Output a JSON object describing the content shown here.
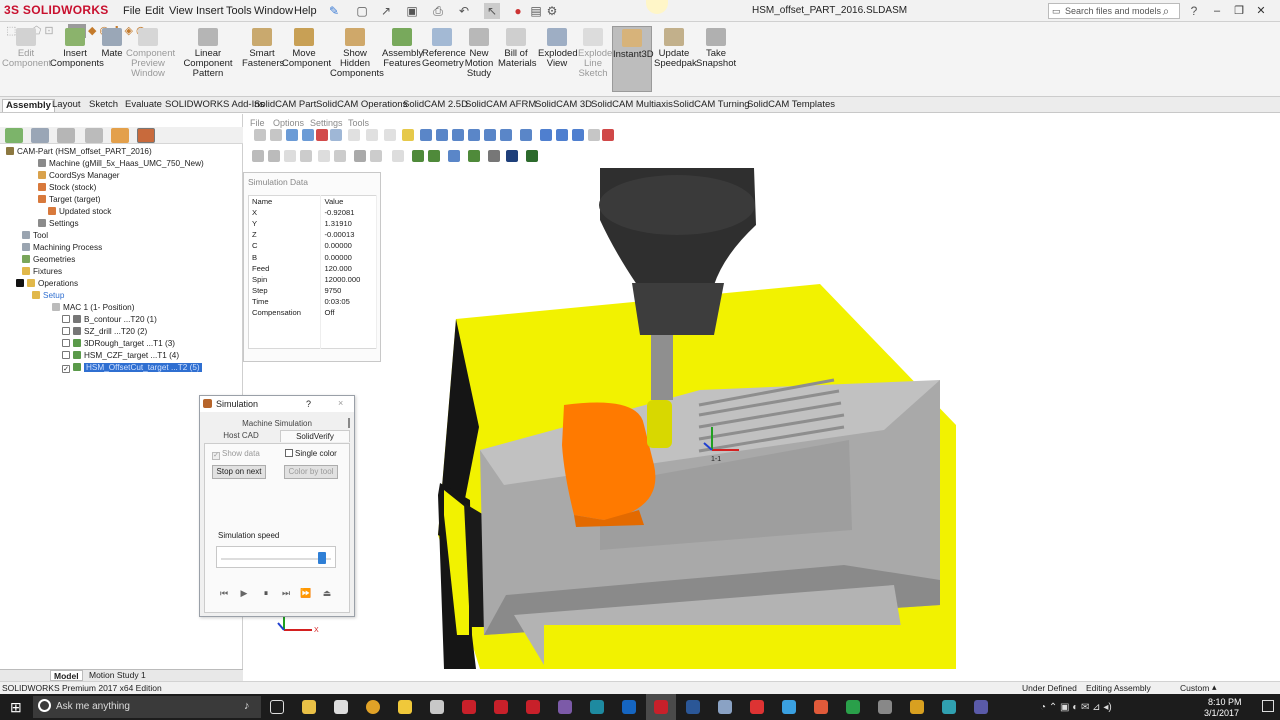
{
  "app": {
    "logo_prefix": "3S",
    "logo": "SOLIDWORKS",
    "document_title": "HSM_offset_PART_2016.SLDASM"
  },
  "menu": [
    "File",
    "Edit",
    "View",
    "Insert",
    "Tools",
    "Window",
    "Help"
  ],
  "search": {
    "placeholder": "Search files and models"
  },
  "toolbar_buttons": [
    {
      "label": "Edit Component",
      "enabled": false
    },
    {
      "label": "Insert Components",
      "enabled": true
    },
    {
      "label": "Mate",
      "enabled": true
    },
    {
      "label": "Component Preview Window",
      "enabled": false
    },
    {
      "label": "Linear Component Pattern",
      "enabled": true
    },
    {
      "label": "Smart Fasteners",
      "enabled": true
    },
    {
      "label": "Move Component",
      "enabled": true
    },
    {
      "label": "Show Hidden Components",
      "enabled": true
    },
    {
      "label": "Assembly Features",
      "enabled": true
    },
    {
      "label": "Reference Geometry",
      "enabled": true
    },
    {
      "label": "New Motion Study",
      "enabled": true
    },
    {
      "label": "Bill of Materials",
      "enabled": true
    },
    {
      "label": "Exploded View",
      "enabled": true
    },
    {
      "label": "Explode Line Sketch",
      "enabled": false
    },
    {
      "label": "Instant3D",
      "enabled": true,
      "active": true
    },
    {
      "label": "Update Speedpak",
      "enabled": true
    },
    {
      "label": "Take Snapshot",
      "enabled": true
    }
  ],
  "tabs": [
    "Assembly",
    "Layout",
    "Sketch",
    "Evaluate",
    "SOLIDWORKS Add-Ins",
    "SolidCAM Part",
    "SolidCAM Operations",
    "SolidCAM 2.5D",
    "SolidCAM AFRM",
    "SolidCAM 3D",
    "SolidCAM Multiaxis",
    "SolidCAM Turning",
    "SolidCAM Templates"
  ],
  "tree": [
    "CAM-Part (HSM_offset_PART_2016)",
    "Machine (gMill_5x_Haas_UMC_750_New)",
    "CoordSys Manager",
    "Stock (stock)",
    "Target (target)",
    "Updated stock",
    "Settings",
    "Tool",
    "Machining Process",
    "Geometries",
    "Fixtures",
    "Operations",
    "Setup",
    "MAC 1 (1- Position)",
    "B_contour ...T20 (1)",
    "SZ_drill ...T20 (2)",
    "3DRough_target ...T1 (3)",
    "HSM_CZF_target ...T1 (4)",
    "HSM_OffsetCut_target ...T2 (5)"
  ],
  "viewport_menu": [
    "File",
    "Options",
    "Settings",
    "Tools"
  ],
  "sim_data": {
    "title": "Simulation Data",
    "headers": [
      "Name",
      "Value"
    ],
    "rows": [
      [
        "X",
        "-0.92081"
      ],
      [
        "Y",
        "1.31910"
      ],
      [
        "Z",
        "-0.00013"
      ],
      [
        "C",
        "0.00000"
      ],
      [
        "B",
        "0.00000"
      ],
      [
        "Feed",
        "120.000"
      ],
      [
        "Spin",
        "12000.000"
      ],
      [
        "Step",
        "9750"
      ],
      [
        "Time",
        "0:03:05"
      ],
      [
        "Compensation",
        "Off"
      ]
    ]
  },
  "sim_dialog": {
    "title": "Simulation",
    "help": "?",
    "close": "×",
    "machine_simulation": "Machine Simulation",
    "tab_host": "Host CAD",
    "tab_solidverify": "SolidVerify",
    "show_data": "Show data",
    "single_color": "Single color",
    "stop_on_next": "Stop on next",
    "color_by_tool": "Color by tool",
    "speed_label": "Simulation speed",
    "speed_fraction": 0.92
  },
  "axes": {
    "x": "X",
    "y": "Y",
    "z": "Z",
    "triad_label": "1-1"
  },
  "bottom_tabs": [
    "Model",
    "Motion Study 1"
  ],
  "status": {
    "edition": "SOLIDWORKS Premium 2017 x64 Edition",
    "definition": "Under Defined",
    "mode": "Editing Assembly",
    "units": "Custom"
  },
  "taskbar": {
    "search": "Ask me anything",
    "time": "8:10 PM",
    "date": "3/1/2017"
  }
}
